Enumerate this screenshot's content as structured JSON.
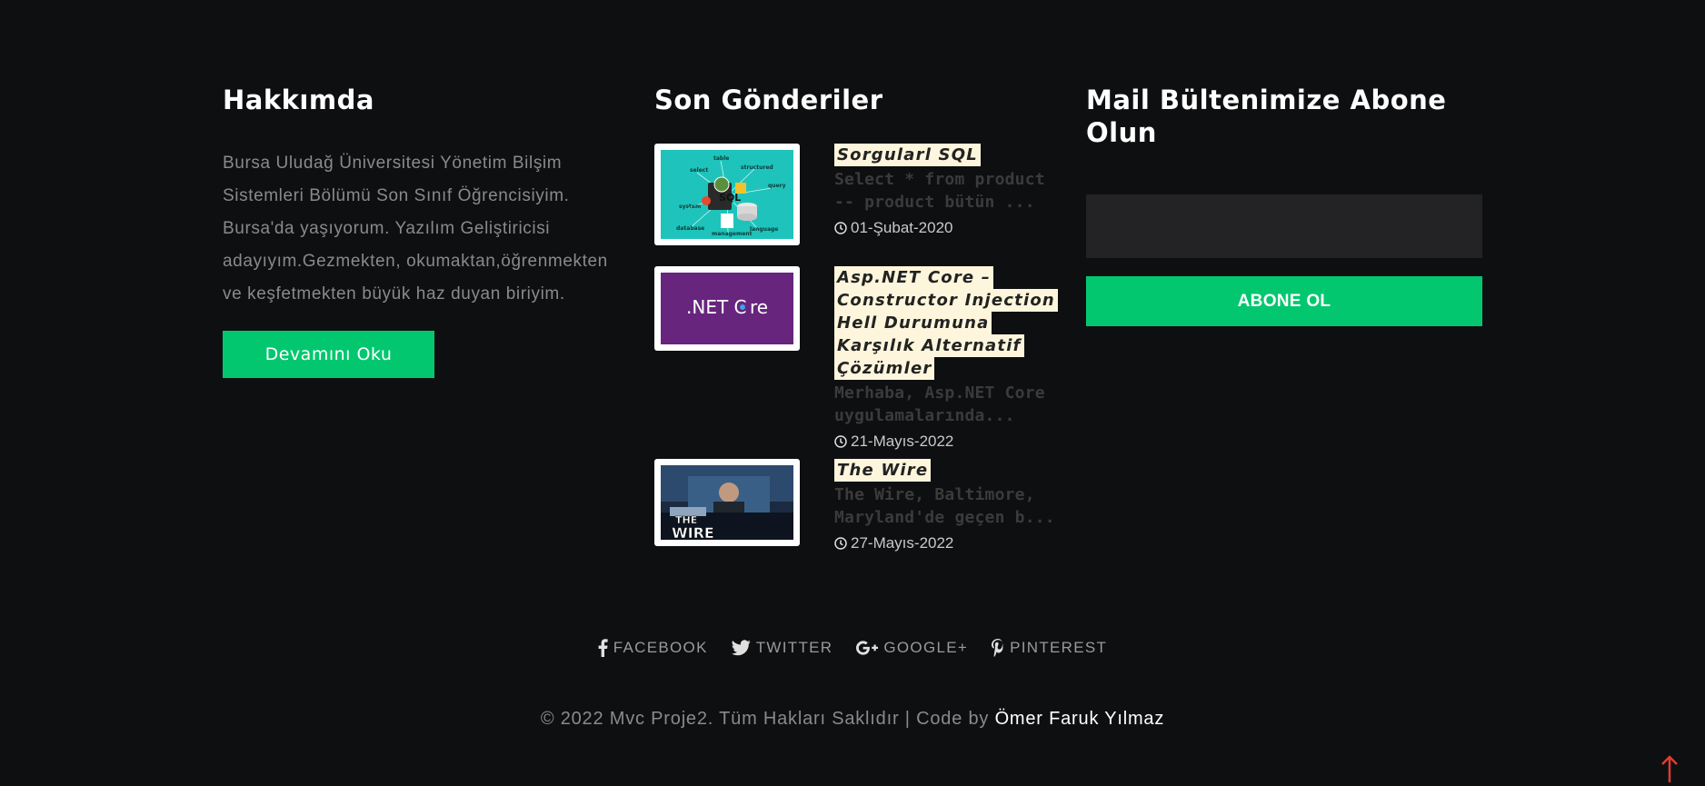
{
  "about": {
    "title": "Hakkımda",
    "text": "Bursa Uludağ Üniversitesi Yönetim Bilşim Sistemleri Bölümü Son Sınıf Öğrencisiyim. Bursa'da yaşıyorum. Yazılım Geliştiricisi adayıyım.Gezmekten, okumaktan,öğrenmekten ve keşfetmekten büyük haz duyan biriyim.",
    "button_label": "Devamını Oku"
  },
  "posts": {
    "title": "Son Gönderiler",
    "items": [
      {
        "title": "Sorgularl SQL",
        "excerpt": "Select * from product -- product bütün ...",
        "date": "01-Şubat-2020",
        "thumb_labels": [
          "table",
          "structured",
          "select",
          "query",
          "SQL",
          "system",
          "database",
          "language",
          "management"
        ]
      },
      {
        "title": "Asp.NET Core – Constructor Injection Hell Durumuna Karşılık Alternatif Çözümler",
        "excerpt": "Merhaba, Asp.NET Core uygulamalarında...",
        "date": "21-Mayıs-2022",
        "thumb_labels": [
          ".NET C",
          "re"
        ]
      },
      {
        "title": "The Wire",
        "excerpt": "The Wire, Baltimore, Maryland'de geçen b...",
        "date": "27-Mayıs-2022",
        "thumb_labels": [
          "THE",
          "WIRE"
        ]
      }
    ]
  },
  "newsletter": {
    "title": "Mail Bültenimize Abone Olun",
    "input_placeholder": "",
    "button_label": "ABONE OL"
  },
  "social": [
    {
      "label": "FACEBOOK",
      "icon": "facebook-icon"
    },
    {
      "label": "TWITTER",
      "icon": "twitter-icon"
    },
    {
      "label": "GOOGLE+",
      "icon": "google-plus-icon"
    },
    {
      "label": "PINTEREST",
      "icon": "pinterest-icon"
    }
  ],
  "footer": {
    "copyright": "© 2022 Mvc Proje2. Tüm Hakları Saklıdır | Code by ",
    "author": "Ömer Faruk Yılmaz"
  },
  "colors": {
    "background": "#0e0f11",
    "accent": "#03c76f",
    "highlight": "#fdf6dc",
    "scroll_top": "#e23b2e"
  }
}
